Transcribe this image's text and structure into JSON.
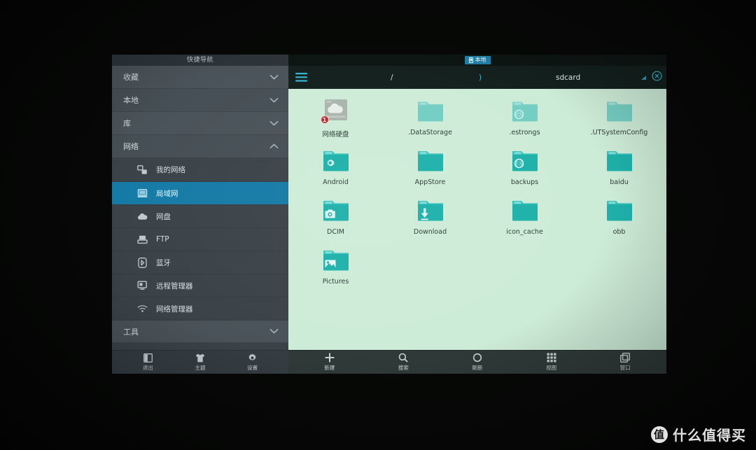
{
  "sidebar": {
    "title": "快捷导航",
    "groups": [
      {
        "label": "收藏",
        "expanded": false,
        "chevron": "chevron-down-icon"
      },
      {
        "label": "本地",
        "expanded": false,
        "chevron": "chevron-down-icon"
      },
      {
        "label": "库",
        "expanded": false,
        "chevron": "chevron-down-icon"
      },
      {
        "label": "网络",
        "expanded": true,
        "chevron": "chevron-up-icon"
      }
    ],
    "network_items": [
      {
        "label": "我的网络",
        "icon": "network-share-icon",
        "active": false
      },
      {
        "label": "局域网",
        "icon": "computer-icon",
        "active": true
      },
      {
        "label": "网盘",
        "icon": "cloud-icon",
        "active": false
      },
      {
        "label": "FTP",
        "icon": "server-icon",
        "active": false
      },
      {
        "label": "蓝牙",
        "icon": "bluetooth-icon",
        "active": false
      },
      {
        "label": "远程管理器",
        "icon": "remote-manager-icon",
        "active": false
      },
      {
        "label": "网络管理器",
        "icon": "wifi-icon",
        "active": false
      }
    ],
    "tools_group": {
      "label": "工具",
      "chevron": "chevron-down-icon"
    },
    "toolbar": [
      {
        "label": "退出",
        "icon": "exit-icon"
      },
      {
        "label": "主题",
        "icon": "tshirt-theme-icon"
      },
      {
        "label": "设置",
        "icon": "gear-icon"
      }
    ]
  },
  "filepanel": {
    "tab": {
      "label": "本地",
      "icon": "device-icon"
    },
    "menu_icon": "hamburger-menu-icon",
    "close_icon": "close-circle-icon",
    "resize_icon": "resize-handle-icon",
    "breadcrumb": {
      "root": "/",
      "separator": ")",
      "leaf": "sdcard"
    },
    "files": [
      {
        "name": "网络硬盘",
        "icon": "cloud-drive-icon",
        "style": "grey-drive",
        "badge": "1"
      },
      {
        "name": ".DataStorage",
        "icon": "folder-icon",
        "style": "pale-folder"
      },
      {
        "name": ".estrongs",
        "icon": "folder-es-icon",
        "style": "pale-folder"
      },
      {
        "name": ".UTSystemConfig",
        "icon": "folder-icon",
        "style": "pale-folder"
      },
      {
        "name": "Android",
        "icon": "folder-gear-icon",
        "style": "folder"
      },
      {
        "name": "AppStore",
        "icon": "folder-icon",
        "style": "folder"
      },
      {
        "name": "backups",
        "icon": "folder-es-icon",
        "style": "folder"
      },
      {
        "name": "baidu",
        "icon": "folder-icon",
        "style": "folder"
      },
      {
        "name": "DCIM",
        "icon": "folder-camera-icon",
        "style": "folder"
      },
      {
        "name": "Download",
        "icon": "folder-download-icon",
        "style": "folder"
      },
      {
        "name": "icon_cache",
        "icon": "folder-icon",
        "style": "folder"
      },
      {
        "name": "obb",
        "icon": "folder-icon",
        "style": "folder"
      },
      {
        "name": "Pictures",
        "icon": "folder-image-icon",
        "style": "folder"
      }
    ],
    "toolbar": [
      {
        "label": "新建",
        "icon": "plus-icon"
      },
      {
        "label": "搜索",
        "icon": "search-icon"
      },
      {
        "label": "刷新",
        "icon": "refresh-icon"
      },
      {
        "label": "视图",
        "icon": "grid-view-icon"
      },
      {
        "label": "窗口",
        "icon": "windows-icon"
      }
    ]
  },
  "watermark": {
    "logo": "值",
    "text": "什么值得买"
  },
  "colors": {
    "sidebar_bg": "#3c464c",
    "sidebar_item_bg": "#3a434a",
    "accent_blue": "#0f7cab",
    "panel_bg": "#cbedd6",
    "folder_teal": "#16b3ad",
    "folder_pale": "#6fcfc4",
    "badge_red": "#c1282d",
    "pathbar_bg": "#12201d"
  }
}
